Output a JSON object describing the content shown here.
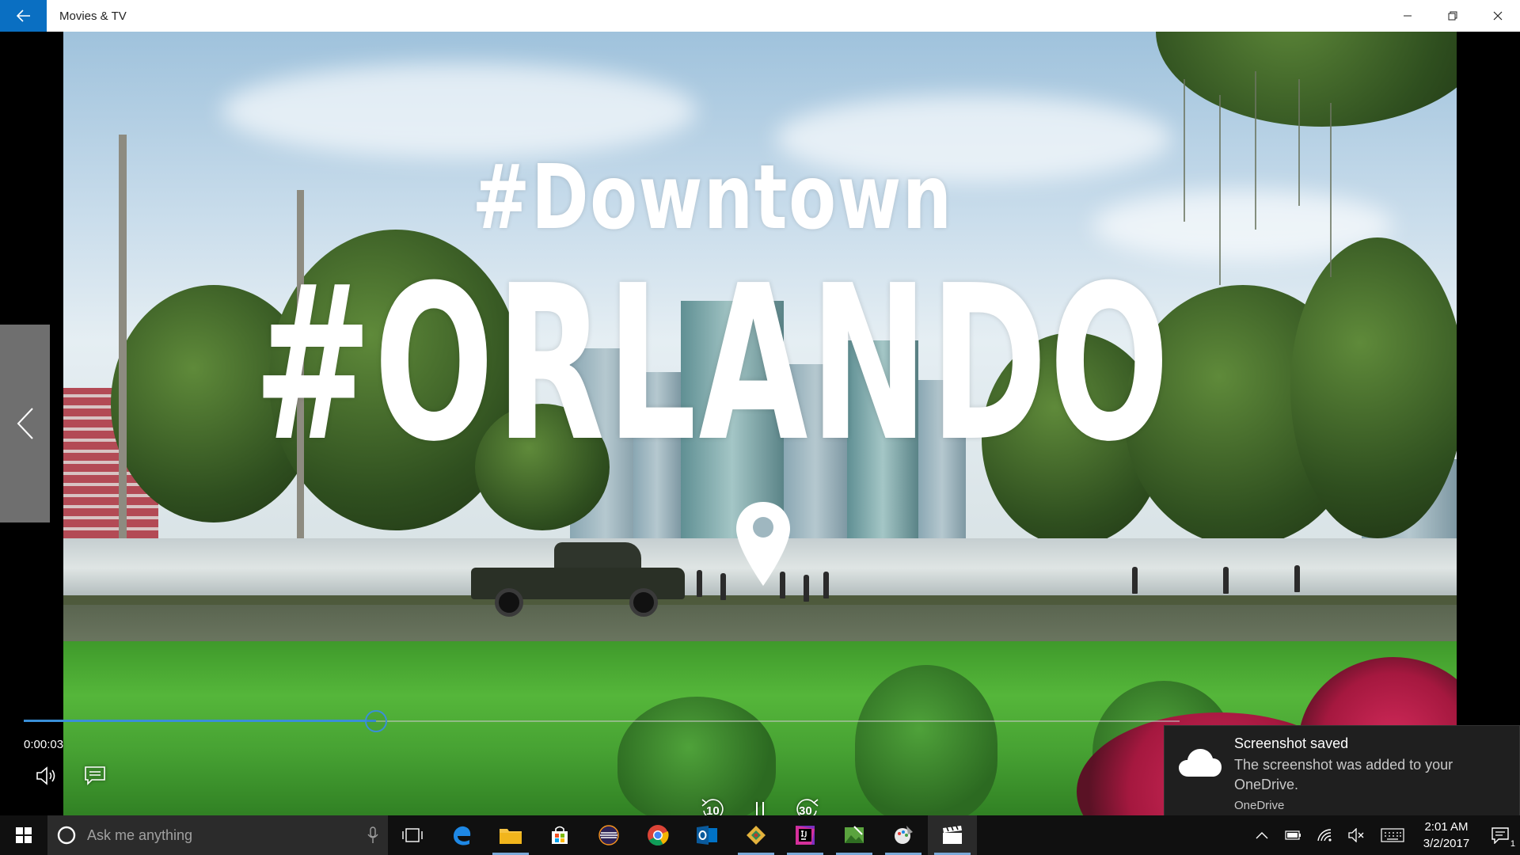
{
  "window": {
    "title": "Movies & TV"
  },
  "video": {
    "overlay_line1": "#Downtown",
    "overlay_line2": "#ORLANDO"
  },
  "player": {
    "elapsed": "0:00:03",
    "progress_fraction": 0.305,
    "skip_back_seconds": "10",
    "skip_forward_seconds": "30",
    "accent_color": "#3a8fd8"
  },
  "toast": {
    "title": "Screenshot saved",
    "body": "The screenshot was added to your OneDrive.",
    "source": "OneDrive"
  },
  "taskbar": {
    "search_placeholder": "Ask me anything",
    "apps": [
      "task-view",
      "edge",
      "file-explorer",
      "store",
      "eclipse",
      "chrome",
      "outlook",
      "sourcetree",
      "intellij",
      "image-editor",
      "paint",
      "movies-and-tv"
    ],
    "time": "2:01 AM",
    "date": "3/2/2017",
    "notification_count": "1"
  }
}
